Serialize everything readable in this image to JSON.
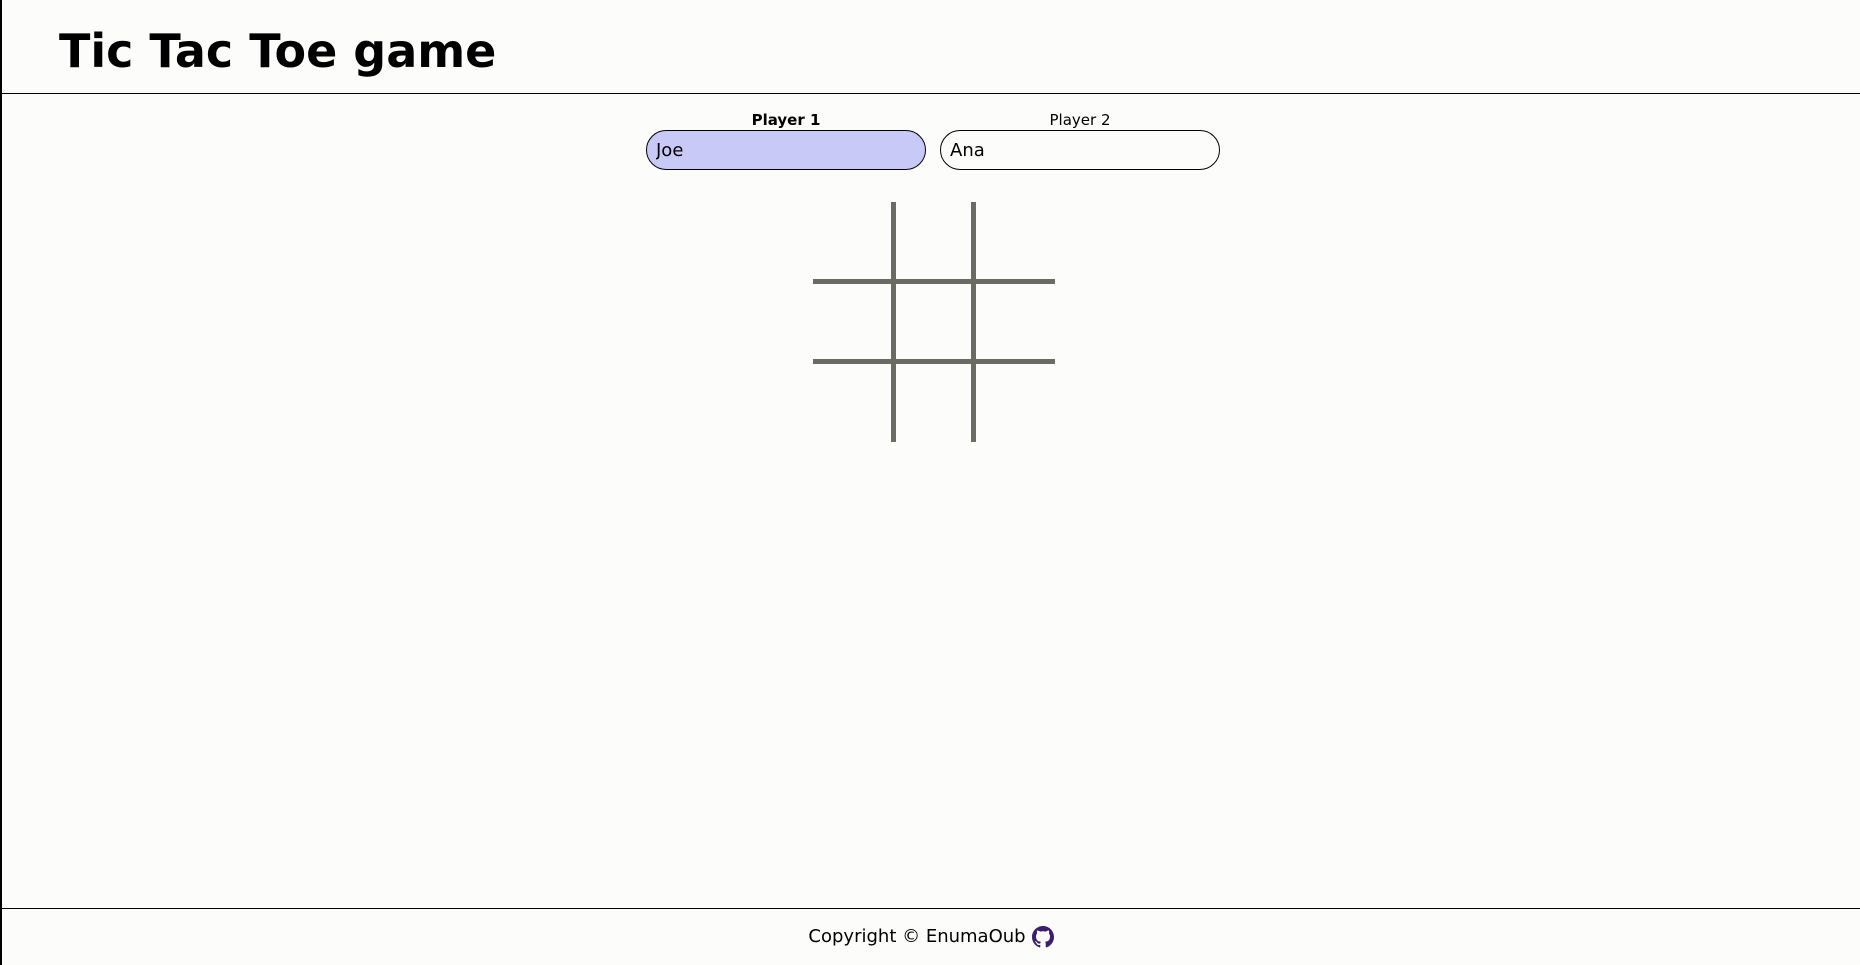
{
  "header": {
    "title": "Tic Tac Toe game"
  },
  "players": [
    {
      "label": "Player 1",
      "name": "Joe",
      "active": true,
      "highlight_color": "#c9c9f7"
    },
    {
      "label": "Player 2",
      "name": "Ana",
      "active": false
    }
  ],
  "board": {
    "cells": [
      "",
      "",
      "",
      "",
      "",
      "",
      "",
      "",
      ""
    ],
    "grid_color": "#6b6b66"
  },
  "footer": {
    "copyright": "Copyright © EnumaOub",
    "icon": "github-icon",
    "icon_color": "#3b1f6e"
  }
}
